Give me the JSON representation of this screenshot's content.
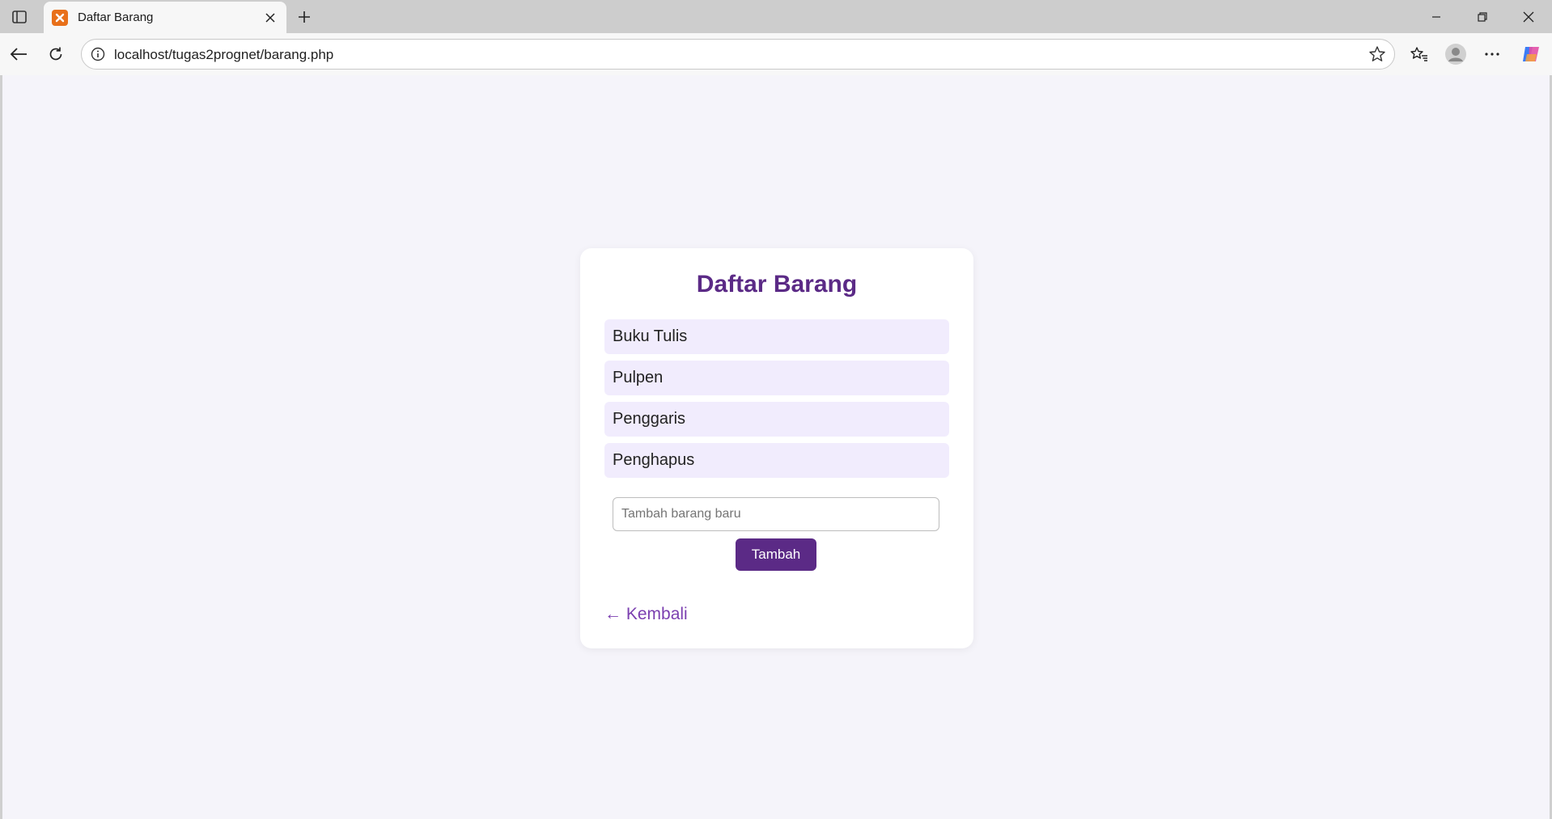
{
  "browser": {
    "tab": {
      "title": "Daftar Barang",
      "favicon": "xampp-icon"
    },
    "address": {
      "url": "localhost/tugas2prognet/barang.php"
    },
    "icons": [
      "tab-actions-icon",
      "close-icon",
      "plus-icon",
      "minimize-icon",
      "restore-icon",
      "close-icon",
      "back-arrow-icon",
      "reload-icon",
      "info-icon",
      "star-icon",
      "favorites-icon",
      "profile-icon",
      "more-icon",
      "copilot-icon"
    ]
  },
  "page": {
    "title": "Daftar Barang",
    "items": [
      {
        "name": "Buku Tulis"
      },
      {
        "name": "Pulpen"
      },
      {
        "name": "Penggaris"
      },
      {
        "name": "Penghapus"
      }
    ],
    "form": {
      "placeholder": "Tambah barang baru",
      "value": "",
      "button_label": "Tambah"
    },
    "back_link": "← Kembali"
  },
  "colors": {
    "accent": "#5b2a86",
    "link": "#7b3fb0",
    "item_bg": "#f1ecfd",
    "page_bg": "#f5f4fa"
  }
}
